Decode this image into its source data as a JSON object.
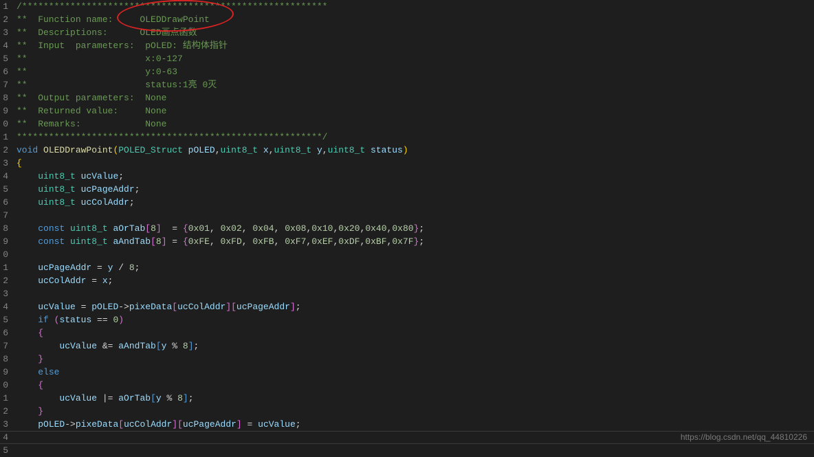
{
  "watermark": "https://blog.csdn.net/qq_44810226",
  "lineStart": 1,
  "lines": [
    {
      "tokens": [
        [
          "c-comment",
          "/*********************************************************"
        ]
      ]
    },
    {
      "tokens": [
        [
          "c-comment",
          "**  Function name:     OLEDDrawPoint"
        ]
      ]
    },
    {
      "tokens": [
        [
          "c-comment",
          "**  Descriptions:      OLED画点函数"
        ]
      ]
    },
    {
      "tokens": [
        [
          "c-comment",
          "**  Input  parameters:  pOLED: 结构体指针"
        ]
      ]
    },
    {
      "tokens": [
        [
          "c-comment",
          "**                      x:0-127"
        ]
      ]
    },
    {
      "tokens": [
        [
          "c-comment",
          "**                      y:0-63"
        ]
      ]
    },
    {
      "tokens": [
        [
          "c-comment",
          "**                      status:1亮 0灭"
        ]
      ]
    },
    {
      "tokens": [
        [
          "c-comment",
          "**  Output parameters:  None"
        ]
      ]
    },
    {
      "tokens": [
        [
          "c-comment",
          "**  Returned value:     None"
        ]
      ]
    },
    {
      "tokens": [
        [
          "c-comment",
          "**  Remarks:            None"
        ]
      ]
    },
    {
      "tokens": [
        [
          "c-comment",
          "*********************************************************/"
        ]
      ]
    },
    {
      "tokens": [
        [
          "c-keyword",
          "void "
        ],
        [
          "c-func",
          "OLEDDrawPoint"
        ],
        [
          "c-yellow",
          "("
        ],
        [
          "c-type",
          "POLED_Struct "
        ],
        [
          "c-param",
          "pOLED"
        ],
        [
          "c-op",
          ","
        ],
        [
          "c-type",
          "uint8_t "
        ],
        [
          "c-param",
          "x"
        ],
        [
          "c-op",
          ","
        ],
        [
          "c-type",
          "uint8_t "
        ],
        [
          "c-param",
          "y"
        ],
        [
          "c-op",
          ","
        ],
        [
          "c-type",
          "uint8_t "
        ],
        [
          "c-param",
          "status"
        ],
        [
          "c-yellow",
          ")"
        ]
      ]
    },
    {
      "tokens": [
        [
          "c-yellow",
          "{"
        ]
      ]
    },
    {
      "tokens": [
        [
          "c-op",
          "    "
        ],
        [
          "c-type",
          "uint8_t "
        ],
        [
          "c-param",
          "ucValue"
        ],
        [
          "c-op",
          ";"
        ]
      ]
    },
    {
      "tokens": [
        [
          "c-op",
          "    "
        ],
        [
          "c-type",
          "uint8_t "
        ],
        [
          "c-param",
          "ucPageAddr"
        ],
        [
          "c-op",
          ";"
        ]
      ]
    },
    {
      "tokens": [
        [
          "c-op",
          "    "
        ],
        [
          "c-type",
          "uint8_t "
        ],
        [
          "c-param",
          "ucColAddr"
        ],
        [
          "c-op",
          ";"
        ]
      ]
    },
    {
      "tokens": [
        [
          "c-op",
          ""
        ]
      ]
    },
    {
      "tokens": [
        [
          "c-op",
          "    "
        ],
        [
          "c-keyword",
          "const "
        ],
        [
          "c-type",
          "uint8_t "
        ],
        [
          "c-param",
          "aOrTab"
        ],
        [
          "c-purple",
          "["
        ],
        [
          "c-num",
          "8"
        ],
        [
          "c-purple",
          "]"
        ],
        [
          "c-op",
          "  = "
        ],
        [
          "c-purple",
          "{"
        ],
        [
          "c-num",
          "0x01"
        ],
        [
          "c-op",
          ", "
        ],
        [
          "c-num",
          "0x02"
        ],
        [
          "c-op",
          ", "
        ],
        [
          "c-num",
          "0x04"
        ],
        [
          "c-op",
          ", "
        ],
        [
          "c-num",
          "0x08"
        ],
        [
          "c-op",
          ","
        ],
        [
          "c-num",
          "0x10"
        ],
        [
          "c-op",
          ","
        ],
        [
          "c-num",
          "0x20"
        ],
        [
          "c-op",
          ","
        ],
        [
          "c-num",
          "0x40"
        ],
        [
          "c-op",
          ","
        ],
        [
          "c-num",
          "0x80"
        ],
        [
          "c-purple",
          "}"
        ],
        [
          "c-op",
          ";"
        ]
      ]
    },
    {
      "tokens": [
        [
          "c-op",
          "    "
        ],
        [
          "c-keyword",
          "const "
        ],
        [
          "c-type",
          "uint8_t "
        ],
        [
          "c-param",
          "aAndTab"
        ],
        [
          "c-purple",
          "["
        ],
        [
          "c-num",
          "8"
        ],
        [
          "c-purple",
          "]"
        ],
        [
          "c-op",
          " = "
        ],
        [
          "c-purple",
          "{"
        ],
        [
          "c-num",
          "0xFE"
        ],
        [
          "c-op",
          ", "
        ],
        [
          "c-num",
          "0xFD"
        ],
        [
          "c-op",
          ", "
        ],
        [
          "c-num",
          "0xFB"
        ],
        [
          "c-op",
          ", "
        ],
        [
          "c-num",
          "0xF7"
        ],
        [
          "c-op",
          ","
        ],
        [
          "c-num",
          "0xEF"
        ],
        [
          "c-op",
          ","
        ],
        [
          "c-num",
          "0xDF"
        ],
        [
          "c-op",
          ","
        ],
        [
          "c-num",
          "0xBF"
        ],
        [
          "c-op",
          ","
        ],
        [
          "c-num",
          "0x7F"
        ],
        [
          "c-purple",
          "}"
        ],
        [
          "c-op",
          ";"
        ]
      ]
    },
    {
      "tokens": [
        [
          "c-op",
          ""
        ]
      ]
    },
    {
      "tokens": [
        [
          "c-op",
          "    "
        ],
        [
          "c-param",
          "ucPageAddr"
        ],
        [
          "c-op",
          " = "
        ],
        [
          "c-param",
          "y"
        ],
        [
          "c-op",
          " / "
        ],
        [
          "c-num",
          "8"
        ],
        [
          "c-op",
          ";"
        ]
      ]
    },
    {
      "tokens": [
        [
          "c-op",
          "    "
        ],
        [
          "c-param",
          "ucColAddr"
        ],
        [
          "c-op",
          " = "
        ],
        [
          "c-param",
          "x"
        ],
        [
          "c-op",
          ";"
        ]
      ]
    },
    {
      "tokens": [
        [
          "c-op",
          ""
        ]
      ]
    },
    {
      "tokens": [
        [
          "c-op",
          "    "
        ],
        [
          "c-param",
          "ucValue"
        ],
        [
          "c-op",
          " = "
        ],
        [
          "c-param",
          "pOLED"
        ],
        [
          "c-op",
          "->"
        ],
        [
          "c-param",
          "pixeData"
        ],
        [
          "c-purple",
          "["
        ],
        [
          "c-param",
          "ucColAddr"
        ],
        [
          "c-purple",
          "]["
        ],
        [
          "c-param",
          "ucPageAddr"
        ],
        [
          "c-purple",
          "]"
        ],
        [
          "c-op",
          ";"
        ]
      ]
    },
    {
      "tokens": [
        [
          "c-op",
          "    "
        ],
        [
          "c-keyword",
          "if "
        ],
        [
          "c-purple",
          "("
        ],
        [
          "c-param",
          "status"
        ],
        [
          "c-op",
          " == "
        ],
        [
          "c-num",
          "0"
        ],
        [
          "c-purple",
          ")"
        ]
      ]
    },
    {
      "tokens": [
        [
          "c-op",
          "    "
        ],
        [
          "c-purple",
          "{"
        ]
      ]
    },
    {
      "tokens": [
        [
          "c-op",
          "        "
        ],
        [
          "c-param",
          "ucValue"
        ],
        [
          "c-op",
          " &= "
        ],
        [
          "c-param",
          "aAndTab"
        ],
        [
          "c-keyword",
          "["
        ],
        [
          "c-param",
          "y"
        ],
        [
          "c-op",
          " % "
        ],
        [
          "c-num",
          "8"
        ],
        [
          "c-keyword",
          "]"
        ],
        [
          "c-op",
          ";"
        ]
      ]
    },
    {
      "tokens": [
        [
          "c-op",
          "    "
        ],
        [
          "c-purple",
          "}"
        ]
      ]
    },
    {
      "tokens": [
        [
          "c-op",
          "    "
        ],
        [
          "c-keyword",
          "else"
        ]
      ]
    },
    {
      "tokens": [
        [
          "c-op",
          "    "
        ],
        [
          "c-purple",
          "{"
        ]
      ]
    },
    {
      "tokens": [
        [
          "c-op",
          "        "
        ],
        [
          "c-param",
          "ucValue"
        ],
        [
          "c-op",
          " |= "
        ],
        [
          "c-param",
          "aOrTab"
        ],
        [
          "c-keyword",
          "["
        ],
        [
          "c-param",
          "y"
        ],
        [
          "c-op",
          " % "
        ],
        [
          "c-num",
          "8"
        ],
        [
          "c-keyword",
          "]"
        ],
        [
          "c-op",
          ";"
        ]
      ]
    },
    {
      "tokens": [
        [
          "c-op",
          "    "
        ],
        [
          "c-purple",
          "}"
        ]
      ]
    },
    {
      "tokens": [
        [
          "c-op",
          "    "
        ],
        [
          "c-param",
          "pOLED"
        ],
        [
          "c-op",
          "->"
        ],
        [
          "c-param",
          "pixeData"
        ],
        [
          "c-purple",
          "["
        ],
        [
          "c-param",
          "ucColAddr"
        ],
        [
          "c-purple",
          "]["
        ],
        [
          "c-param",
          "ucPageAddr"
        ],
        [
          "c-purple",
          "]"
        ],
        [
          "c-op",
          " = "
        ],
        [
          "c-param",
          "ucValue"
        ],
        [
          "c-op",
          ";"
        ]
      ]
    },
    {
      "tokens": [
        [
          "c-op",
          ""
        ]
      ]
    },
    {
      "tokens": [
        [
          "c-op",
          ""
        ]
      ]
    }
  ]
}
